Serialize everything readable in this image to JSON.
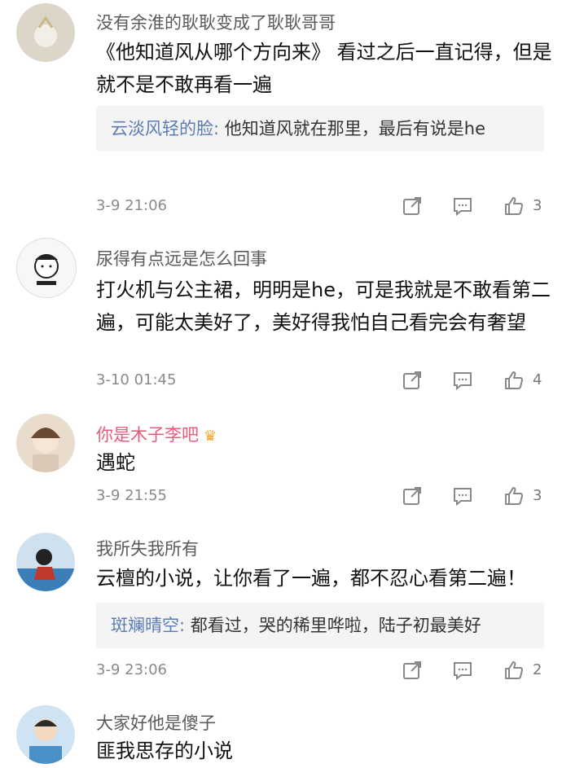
{
  "comments": [
    {
      "username": "没有余淮的耿耿变成了耿耿哥哥",
      "text": "《他知道风从哪个方向来》 看过之后一直记得，但是就不是不敢再看一遍",
      "reply_name": "云淡风轻的脸",
      "reply_text": "他知道风就在那里，最后有说是he",
      "time": "3-9 21:06",
      "likes": "3"
    },
    {
      "username": "尿得有点远是怎么回事",
      "text": "打火机与公主裙，明明是he，可是我就是不敢看第二遍，可能太美好了，美好得我怕自己看完会有奢望",
      "time": "3-10 01:45",
      "likes": "4"
    },
    {
      "username": "你是木子李吧",
      "text": "遇蛇",
      "time": "3-9 21:55",
      "likes": "3"
    },
    {
      "username": "我所失我所有",
      "text": "云檀的小说，让你看了一遍，都不忍心看第二遍！",
      "reply_name": "斑斓晴空",
      "reply_text": "都看过，哭的稀里哗啦，陆子初最美好",
      "time": "3-9 23:06",
      "likes": "2"
    },
    {
      "username": "大家好他是傻子",
      "text": "匪我思存的小说"
    }
  ],
  "reply_sep": ": ",
  "icons": {
    "share": "share-icon",
    "comment": "comment-icon",
    "like": "thumbs-up-icon",
    "crown": "crown-icon"
  },
  "colors": {
    "username": "#5a5a5a",
    "vip_username": "#e85b7a",
    "reply_name": "#5b7cb4",
    "reply_bg": "#f4f4f4"
  }
}
